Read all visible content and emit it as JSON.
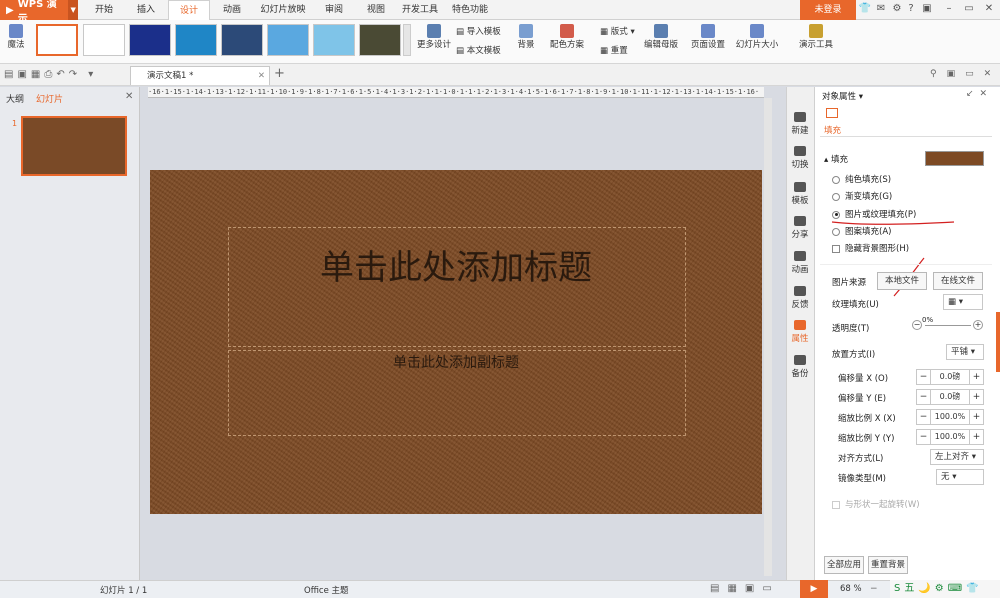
{
  "app": {
    "name": "WPS 演示",
    "login": "未登录"
  },
  "menu_tabs": [
    "开始",
    "插入",
    "设计",
    "动画",
    "幻灯片放映",
    "审阅",
    "视图",
    "开发工具",
    "特色功能"
  ],
  "active_tab": "设计",
  "ribbon": {
    "magic": "魔法",
    "more_design": "更多设计",
    "import_template": "导入模板",
    "this_template": "本文模板",
    "background": "背景",
    "color_scheme": "配色方案",
    "layout": "版式",
    "reset": "重置",
    "edit_master": "编辑母版",
    "page_setup": "页面设置",
    "slide_size": "幻灯片大小",
    "show_tools": "演示工具"
  },
  "document_tab": "演示文稿1 *",
  "left_panel": {
    "tab_outline": "大纲",
    "tab_slides": "幻灯片",
    "slide_number": "1"
  },
  "ruler_text": "·16·1·15·1·14·1·13·1·12·1·11·1·10·1·9·1·8·1·7·1·6·1·5·1·4·1·3·1·2·1·1·1·0·1·1·1·2·1·3·1·4·1·5·1·6·1·7·1·8·1·9·1·10·1·11·1·12·1·13·1·14·1·15·1·16·",
  "slide": {
    "title": "单击此处添加标题",
    "subtitle": "单击此处添加副标题"
  },
  "side_strip": [
    "新建",
    "切换",
    "模板",
    "分享",
    "动画",
    "反馈",
    "属性",
    "备份"
  ],
  "pane": {
    "header": "对象属性",
    "tab_fill": "填充",
    "section_fill": "填充",
    "fill_options": [
      "纯色填充(S)",
      "渐变填充(G)",
      "图片或纹理填充(P)",
      "图案填充(A)"
    ],
    "selected_fill": 2,
    "hide_bg": "隐藏背景图形(H)",
    "picture_source_label": "图片来源",
    "local_file": "本地文件",
    "online_file": "在线文件",
    "texture_fill_label": "纹理填充(U)",
    "transparency_label": "透明度(T)",
    "transparency_value": "0%",
    "placement_label": "放置方式(I)",
    "placement_value": "平铺",
    "offset_x_label": "偏移量 X (O)",
    "offset_x_value": "0.0磅",
    "offset_y_label": "偏移量 Y (E)",
    "offset_y_value": "0.0磅",
    "scale_x_label": "缩放比例 X (X)",
    "scale_x_value": "100.0%",
    "scale_y_label": "缩放比例 Y (Y)",
    "scale_y_value": "100.0%",
    "align_label": "对齐方式(L)",
    "align_value": "左上对齐",
    "mirror_label": "镜像类型(M)",
    "mirror_value": "无",
    "rotate_with": "与形状一起旋转(W)",
    "apply_all": "全部应用",
    "reset_bg": "重置背景"
  },
  "status": {
    "slide_count": "幻灯片 1 / 1",
    "theme": "Office 主题",
    "zoom": "68 %"
  },
  "colors": {
    "accent": "#e8672b",
    "slide_bg": "#7d4a24"
  }
}
